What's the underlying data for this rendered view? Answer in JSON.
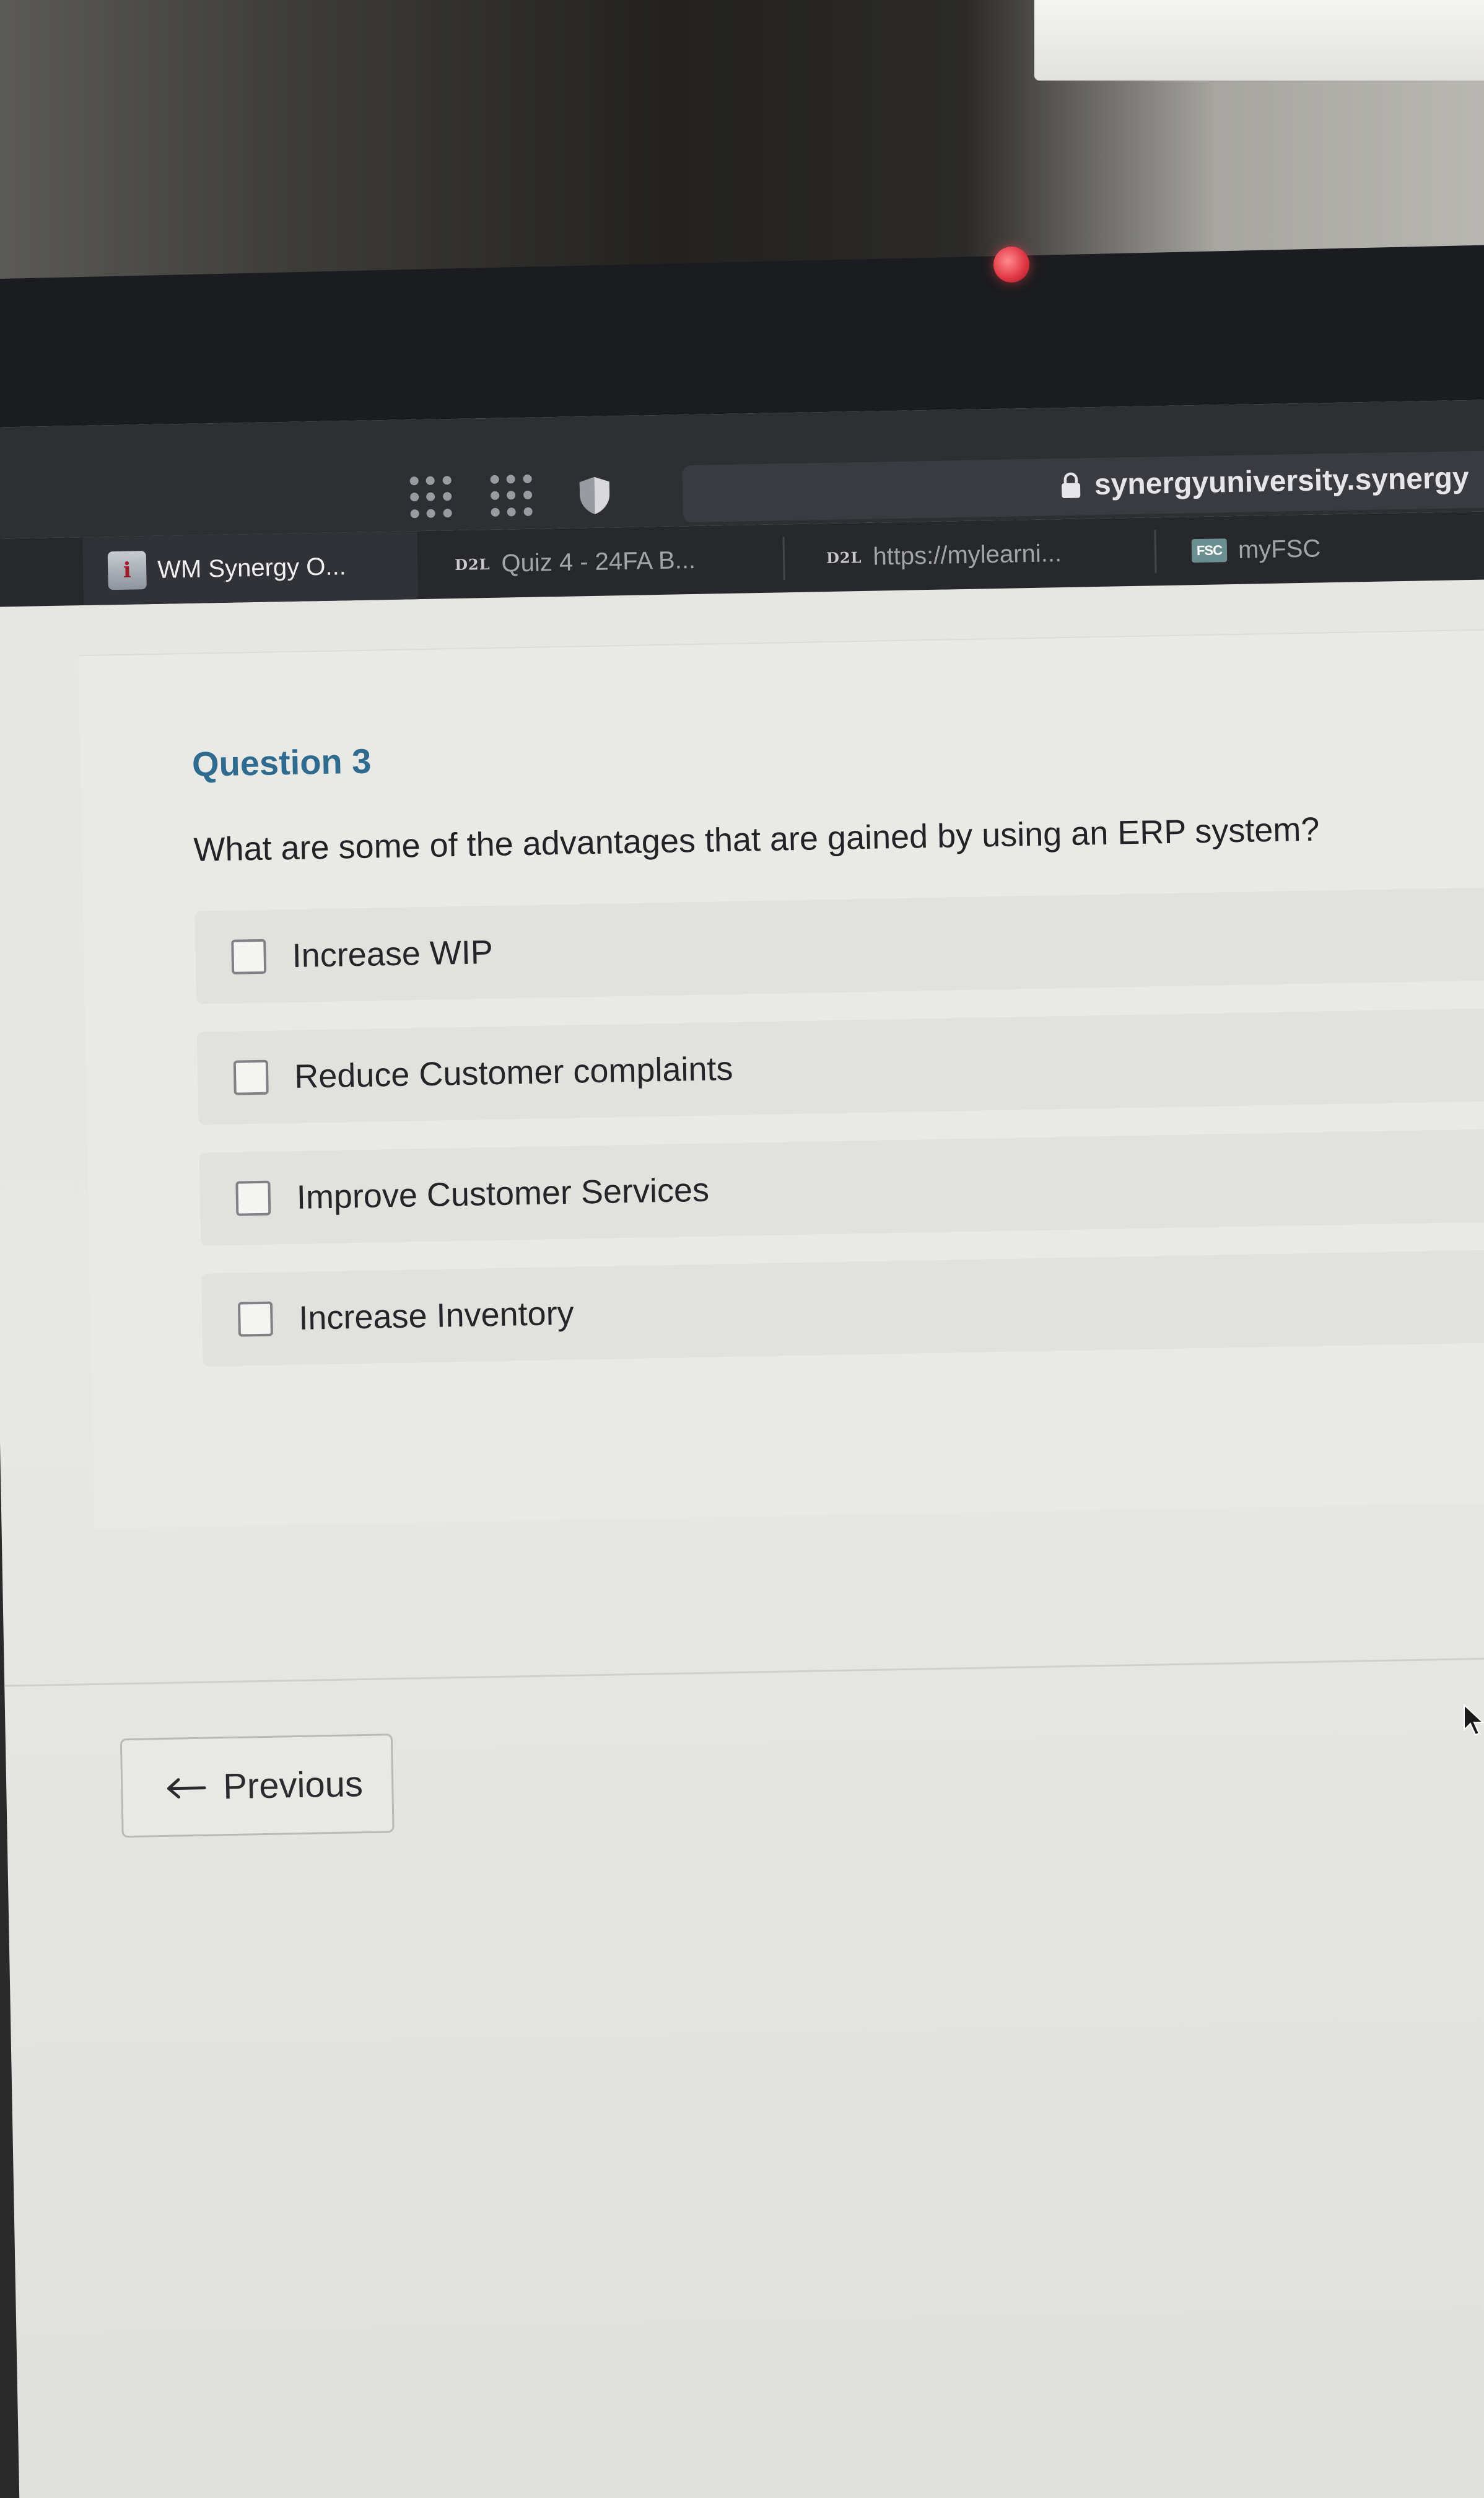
{
  "browser": {
    "url": "synergyuniversity.synergy",
    "tabs": [
      {
        "label": "WM Synergy O...",
        "icon": "wm-logo"
      },
      {
        "label": "Quiz 4 - 24FA B...",
        "icon": "d2l-logo"
      },
      {
        "label": "https://mylearni...",
        "icon": "d2l-logo"
      },
      {
        "label": "myFSC",
        "icon": "fsc-logo"
      }
    ],
    "logos": {
      "d2l": "D2L",
      "fsc": "FSC"
    }
  },
  "quiz": {
    "question_title": "Question 3",
    "question_text": "What are some of the advantages that are gained by using an ERP system?",
    "options": [
      {
        "label": "Increase WIP",
        "checked": false
      },
      {
        "label": "Reduce Customer complaints",
        "checked": false
      },
      {
        "label": "Improve Customer Services",
        "checked": false
      },
      {
        "label": "Increase Inventory",
        "checked": false
      }
    ],
    "previous_label": "Previous"
  },
  "colors": {
    "question_title": "#2f6b8f",
    "toolbar": "#2e2f33",
    "page_bg": "#e5e5e2"
  }
}
